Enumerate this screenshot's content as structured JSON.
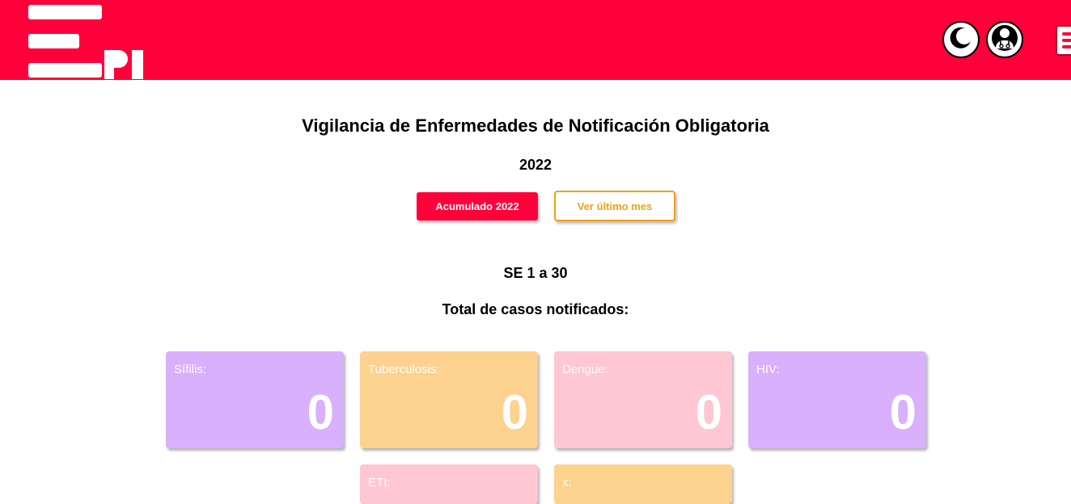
{
  "header": {
    "theme_toggle_icon": "moon-icon",
    "doctor_icon": "doctor-icon",
    "menu_icon": "hamburger-menu-icon",
    "brand_color": "#ff003a"
  },
  "main": {
    "title": "Vigilancia de Enfermedades de Notificación Obligatoria",
    "year": "2022",
    "buttons": {
      "accumulated": "Acumulado 2022",
      "last_month": "Ver último mes"
    },
    "period": "SE 1 a 30",
    "total_heading": "Total de casos notificados:",
    "cards": [
      {
        "label": "Sífilis:",
        "value": "0",
        "color": "#d9b0fb"
      },
      {
        "label": "Tuberculosis:",
        "value": "0",
        "color": "#fdd28e"
      },
      {
        "label": "Dengue:",
        "value": "0",
        "color": "#ffc6d4"
      },
      {
        "label": "HIV:",
        "value": "0",
        "color": "#d9b0fb"
      },
      {
        "label": "ETI:",
        "value": "",
        "color": "#ffc6d4"
      },
      {
        "label": "x:",
        "value": "",
        "color": "#fdd28e"
      }
    ]
  }
}
